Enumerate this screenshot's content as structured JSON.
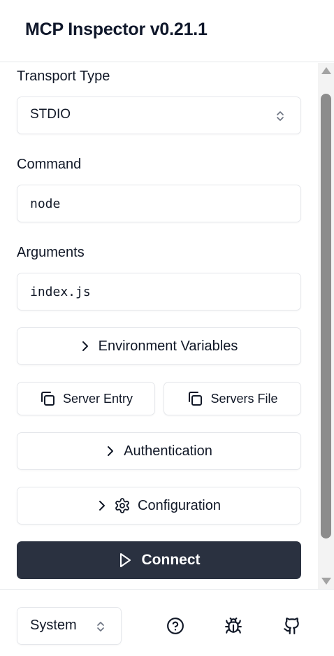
{
  "app": {
    "title": "MCP Inspector v0.21.1"
  },
  "transport": {
    "label": "Transport Type",
    "value": "STDIO"
  },
  "command": {
    "label": "Command",
    "value": "node"
  },
  "arguments": {
    "label": "Arguments",
    "value": "index.js"
  },
  "buttons": {
    "env_vars": "Environment Variables",
    "server_entry": "Server Entry",
    "servers_file": "Servers File",
    "authentication": "Authentication",
    "configuration": "Configuration",
    "connect": "Connect"
  },
  "footer": {
    "theme": "System",
    "icons": [
      "help-circle-icon",
      "bug-icon",
      "github-icon"
    ]
  },
  "colors": {
    "connect_bg": "#2a3140",
    "border": "#e5e7eb"
  }
}
